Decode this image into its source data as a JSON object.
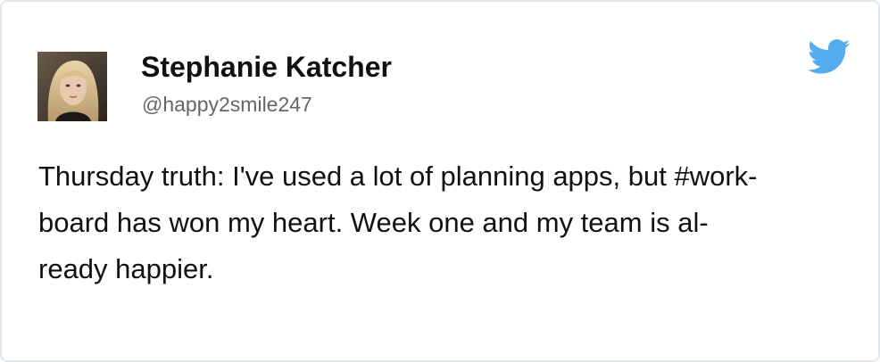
{
  "tweet": {
    "author": {
      "name": "Stephanie Katcher",
      "handle": "@happy2smile247"
    },
    "text_lines": [
      "Thursday truth: I've used a lot of planning apps, but #work-",
      "board has won my heart. Week one and my team is al-",
      "ready happier."
    ],
    "icons": {
      "brand": "twitter-bird-icon",
      "avatar": "profile-photo"
    },
    "colors": {
      "twitter_blue": "#55acee",
      "border": "#e1e8ed",
      "handle_gray": "#666666"
    }
  }
}
